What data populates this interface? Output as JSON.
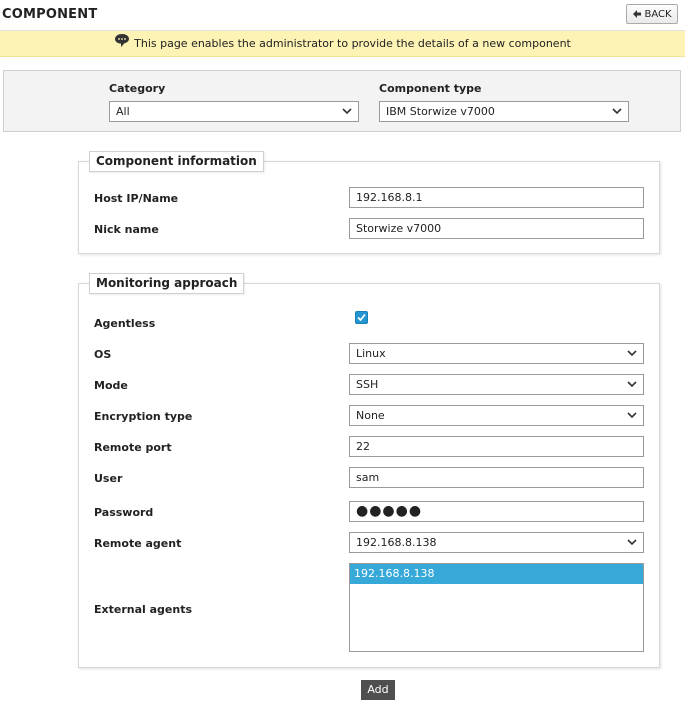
{
  "header": {
    "title": "COMPONENT",
    "back_label": "BACK"
  },
  "banner": {
    "text": "This page enables the administrator to provide the details of a new component"
  },
  "filters": {
    "category_label": "Category",
    "category_value": "All",
    "component_type_label": "Component type",
    "component_type_value": "IBM Storwize v7000"
  },
  "component_info": {
    "legend": "Component information",
    "host_label": "Host IP/Name",
    "host_value": "192.168.8.1",
    "nick_label": "Nick name",
    "nick_value": "Storwize v7000"
  },
  "monitoring": {
    "legend": "Monitoring approach",
    "agentless_label": "Agentless",
    "agentless_checked": true,
    "os_label": "OS",
    "os_value": "Linux",
    "mode_label": "Mode",
    "mode_value": "SSH",
    "encryption_label": "Encryption type",
    "encryption_value": "None",
    "port_label": "Remote port",
    "port_value": "22",
    "user_label": "User",
    "user_value": "sam",
    "password_label": "Password",
    "password_value": "●●●●●",
    "remote_agent_label": "Remote agent",
    "remote_agent_value": "192.168.8.138",
    "external_agents_label": "External agents",
    "external_agents": [
      "192.168.8.138"
    ]
  },
  "actions": {
    "add_label": "Add"
  },
  "colors": {
    "accent": "#36a9d9",
    "banner": "#fdf3b5",
    "button_dark": "#4f4f4f"
  }
}
